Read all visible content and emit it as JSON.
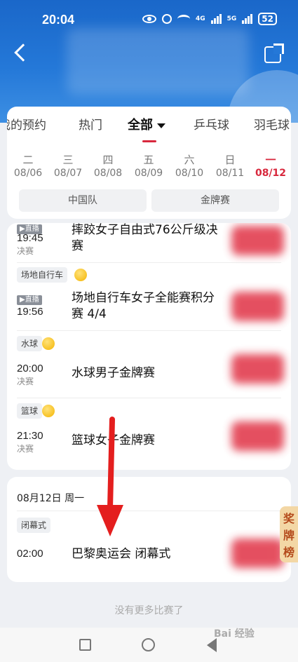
{
  "status_bar": {
    "time": "20:04",
    "battery": "52",
    "net1": "4G",
    "net2": "5G"
  },
  "tabs": [
    "我的预约",
    "热门",
    "全部",
    "乒乓球",
    "羽毛球"
  ],
  "dates": [
    {
      "weekday": "二",
      "date": "08/06"
    },
    {
      "weekday": "三",
      "date": "08/07"
    },
    {
      "weekday": "四",
      "date": "08/08"
    },
    {
      "weekday": "五",
      "date": "08/09"
    },
    {
      "weekday": "六",
      "date": "08/10"
    },
    {
      "weekday": "日",
      "date": "08/11"
    },
    {
      "weekday": "一",
      "date": "08/12"
    }
  ],
  "filters": [
    "中国队",
    "金牌赛"
  ],
  "events_block1": [
    {
      "live_label": "直播",
      "time": "19:45",
      "stage": "决赛",
      "name": "摔跤女子自由式76公斤级决赛"
    },
    {
      "sport": "场地自行车",
      "live_label": "直播",
      "time": "19:56",
      "name": "场地自行车女子全能赛积分赛 4/4"
    },
    {
      "sport": "水球",
      "time": "20:00",
      "stage": "决赛",
      "name": "水球男子金牌赛"
    },
    {
      "sport": "篮球",
      "time": "21:30",
      "stage": "决赛",
      "name": "篮球女子金牌赛"
    }
  ],
  "day2": {
    "header": "08月12日 周一",
    "event": {
      "sport": "闭幕式",
      "time": "02:00",
      "name": "巴黎奥运会 闭幕式"
    }
  },
  "no_more": "没有更多比赛了",
  "award_tab": "奖牌榜",
  "watermark": "Bai 经验",
  "colors": {
    "accent": "#d8283d",
    "header": "#2478d8",
    "medal": "#f4b400"
  }
}
